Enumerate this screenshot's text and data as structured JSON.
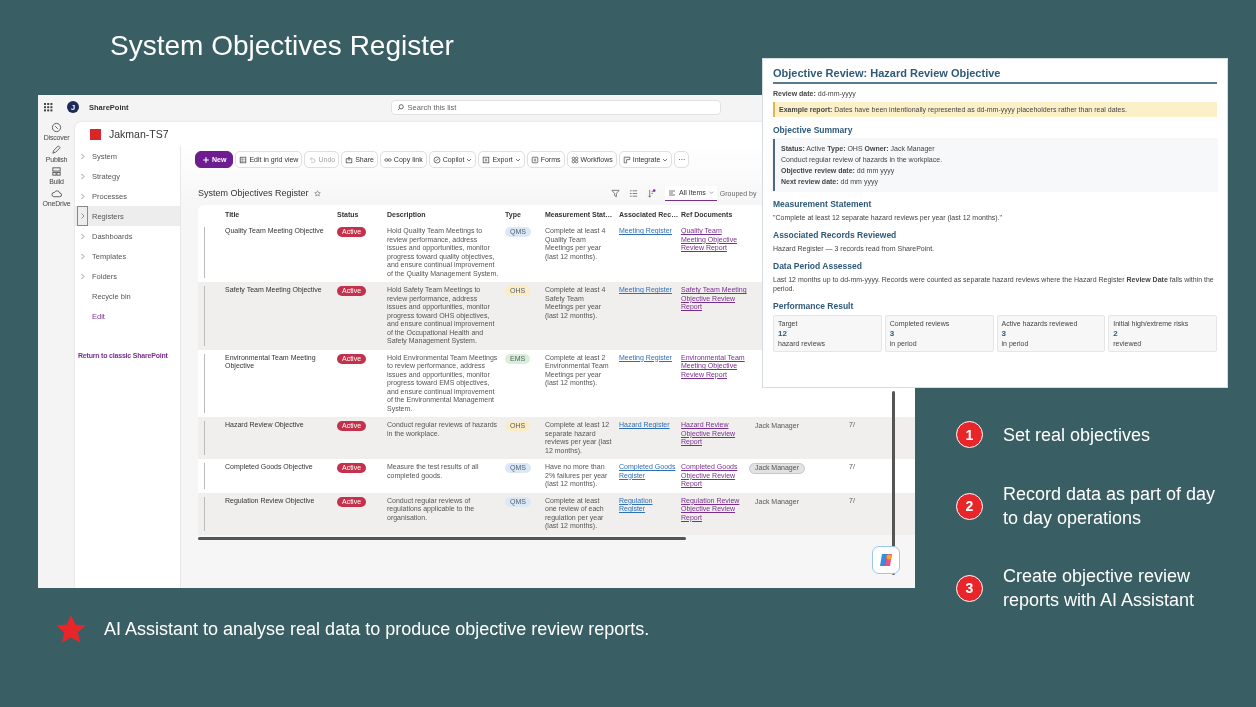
{
  "slide": {
    "title": "System Objectives Register",
    "steps": [
      {
        "number": "1",
        "text": "Set real objectives"
      },
      {
        "number": "2",
        "text": "Record data as part of day to day operations"
      },
      {
        "number": "3",
        "text": "Create objective review reports with AI Assistant"
      }
    ],
    "footnote": "AI Assistant to analyse real data to produce objective review reports."
  },
  "sharepoint": {
    "app_name": "SharePoint",
    "avatar_initial": "J",
    "search_placeholder": "Search this list",
    "rail": [
      {
        "label": "Discover"
      },
      {
        "label": "Publish"
      },
      {
        "label": "Build"
      },
      {
        "label": "OneDrive"
      }
    ],
    "site_name": "Jakman-TS7",
    "nav": [
      {
        "label": "System",
        "kind": "section",
        "selected": false
      },
      {
        "label": "Strategy",
        "kind": "section",
        "selected": false
      },
      {
        "label": "Processes",
        "kind": "section",
        "selected": false
      },
      {
        "label": "Registers",
        "kind": "section",
        "selected": true
      },
      {
        "label": "Dashboards",
        "kind": "section",
        "selected": false
      },
      {
        "label": "Templates",
        "kind": "section",
        "selected": false
      },
      {
        "label": "Folders",
        "kind": "section",
        "selected": false
      },
      {
        "label": "Recycle bin",
        "kind": "page",
        "selected": false
      },
      {
        "label": "Edit",
        "kind": "action",
        "selected": false
      }
    ],
    "nav_footer_link": "Return to classic SharePoint",
    "toolbar": [
      {
        "label": "New",
        "kind": "primary",
        "disabled": false
      },
      {
        "label": "Edit in grid view",
        "kind": "button",
        "disabled": false
      },
      {
        "label": "Undo",
        "kind": "button",
        "disabled": true
      },
      {
        "label": "Share",
        "kind": "button",
        "disabled": false
      },
      {
        "label": "Copy link",
        "kind": "button",
        "disabled": false
      },
      {
        "label": "Copilot",
        "kind": "menu",
        "disabled": false
      },
      {
        "label": "Export",
        "kind": "menu",
        "disabled": false
      },
      {
        "label": "Forms",
        "kind": "button",
        "disabled": false
      },
      {
        "label": "Workflows",
        "kind": "button",
        "disabled": false
      },
      {
        "label": "Integrate",
        "kind": "menu",
        "disabled": false
      },
      {
        "label": "···",
        "kind": "more",
        "disabled": false
      }
    ],
    "list_title": "System Objectives Register",
    "view_label": "All Items",
    "grouped_label": "Grouped by",
    "columns": [
      "Title",
      "Status",
      "Description",
      "Type",
      "Measurement Stat…",
      "Associated Rec…",
      "Ref Documents"
    ],
    "rows": [
      {
        "title": "Quality Team Meeting Objective",
        "status": "Active",
        "description": "Hold Quality Team Meetings to review performance, address issues and opportunities, monitor progress toward quality objectives, and ensure continual improvement of the Quality Management System.",
        "type": {
          "label": "QMS",
          "color": "#dce8f6"
        },
        "measurement": "Complete at least 4 Quality Team Meetings per year (last 12 months).",
        "associated": "Meeting Register",
        "ref_document": "Quality Team Meeting Objective Review Report"
      },
      {
        "title": "Safety Team Meeting Objective",
        "status": "Active",
        "description": "Hold Safety Team Meetings to review performance, address issues and opportunities, monitor progress toward OHS objectives, and ensure continual improvement of the Occupational Health and Safety Management System.",
        "type": {
          "label": "OHS",
          "color": "#fbecc4"
        },
        "measurement": "Complete at least 4 Safety Team Meetings per year (last 12 months).",
        "associated": "Meeting Register",
        "ref_document": "Safety Team Meeting Objective Review Report"
      },
      {
        "title": "Environmental Team Meeting Objective",
        "status": "Active",
        "description": "Hold Environmental Team Meetings to review performance, address issues and opportunities, monitor progress toward EMS objectives, and ensure continual improvement of the Environmental Management System.",
        "type": {
          "label": "EMS",
          "color": "#d9efd8"
        },
        "measurement": "Complete at least 2 Environmental Team Meetings per year (last 12 months).",
        "associated": "Meeting Register",
        "ref_document": "Environmental Team Meeting Objective Review Report"
      },
      {
        "title": "Hazard Review Objective",
        "status": "Active",
        "description": "Conduct regular reviews of hazards in the workplace.",
        "type": {
          "label": "OHS",
          "color": "#fbecc4"
        },
        "measurement": "Complete at least 12 separate hazard reviews per year (last 12 months).",
        "associated": "Hazard Register",
        "ref_document": "Hazard Review Objective Review Report",
        "owner": "Jack Manager",
        "owner_chip": false,
        "date": "7/"
      },
      {
        "title": "Completed Goods Objective",
        "status": "Active",
        "description": "Measure the test results of all completed goods.",
        "type": {
          "label": "QMS",
          "color": "#dce8f6"
        },
        "measurement": "Have no more than 2% failures per year (last 12 months).",
        "associated": "Completed Goods Register",
        "ref_document": "Completed Goods Objective Review Report",
        "owner": "Jack Manager",
        "owner_chip": true,
        "date": "7/"
      },
      {
        "title": "Regulation Review Objective",
        "status": "Active",
        "description": "Conduct regular reviews of regulations applicable to the organisation.",
        "type": {
          "label": "QMS",
          "color": "#dce8f6"
        },
        "measurement": "Complete at least one review of each regulation per year (last 12 months).",
        "associated": "Regulation Register",
        "ref_document": "Regulation Review Objective Review Report",
        "owner": "Jack Manager",
        "owner_chip": false,
        "date": "7/"
      }
    ]
  },
  "report": {
    "title": "Objective Review: Hazard Review Objective",
    "review_date": "**Review date:** dd-mm-yyyy",
    "note": "**Example report:** Dates have been intentionally represented as dd-mm-yyyy placeholders rather than real dates.",
    "sections": [
      {
        "heading": "Objective Summary",
        "kind": "summary",
        "lines": [
          "**Status:** Active   **Type:** OHS   **Owner:** Jack Manager",
          "Conduct regular review of hazards in the workplace.",
          "**Objective review date:** dd mm yyyy",
          "**Next review date:** dd mm yyyy"
        ]
      },
      {
        "heading": "Measurement Statement",
        "kind": "text",
        "text": "\"Complete at least 12 separate hazard reviews per year (last 12 months).\""
      },
      {
        "heading": "Associated Records Reviewed",
        "kind": "text",
        "text": "Hazard Register — 3 records read from SharePoint."
      },
      {
        "heading": "Data Period Assessed",
        "kind": "text",
        "text": "Last 12 months up to dd-mm-yyyy. Records were counted as separate hazard reviews where the Hazard Register **Review Date** falls within the period."
      },
      {
        "heading": "Performance Result",
        "kind": "metrics",
        "cards": [
          {
            "label": "Target",
            "value": "12",
            "unit": "hazard reviews"
          },
          {
            "label": "Completed reviews",
            "value": "3",
            "unit": "in period"
          },
          {
            "label": "Active hazards reviewed",
            "value": "3",
            "unit": "in period"
          },
          {
            "label": "Initial high/extreme risks",
            "value": "2",
            "unit": "reviewed"
          }
        ]
      }
    ]
  }
}
